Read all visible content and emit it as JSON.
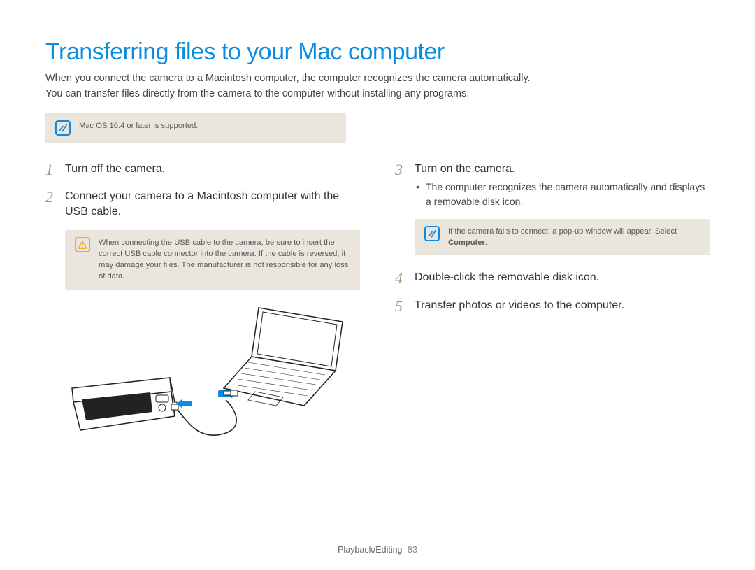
{
  "title": "Transferring files to your Mac computer",
  "intro_line1": "When you connect the camera to a Macintosh computer, the computer recognizes the camera automatically.",
  "intro_line2": "You can transfer files directly from the camera to the computer without installing any programs.",
  "top_note": "Mac OS 10.4 or later is supported.",
  "left": {
    "step1_num": "1",
    "step1_text": "Turn off the camera.",
    "step2_num": "2",
    "step2_text": "Connect your camera to a Macintosh computer with the USB cable.",
    "warn_text": "When connecting the USB cable to the camera, be sure to insert the correct USB cable connector into the camera. If the cable is reversed, it may damage your files. The manufacturer is not responsible for any loss of data."
  },
  "right": {
    "step3_num": "3",
    "step3_text": "Turn on the camera.",
    "step3_bullet": "The computer recognizes the camera automatically and displays a removable disk icon.",
    "note_text_pre": "If the camera fails to connect, a pop-up window will appear. Select ",
    "note_text_bold": "Computer",
    "note_text_post": ".",
    "step4_num": "4",
    "step4_text": "Double-click the removable disk icon.",
    "step5_num": "5",
    "step5_text": "Transfer photos or videos to the computer."
  },
  "footer_section": "Playback/Editing",
  "footer_page": "83"
}
